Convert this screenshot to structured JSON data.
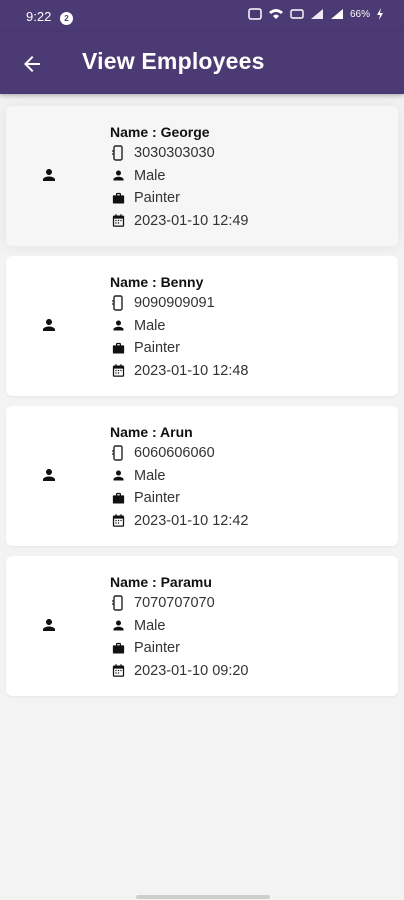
{
  "status": {
    "time": "9:22",
    "badge": "2",
    "battery": "66%"
  },
  "appbar": {
    "title": "View Employees"
  },
  "employees": [
    {
      "name": "Name : George",
      "phone": "3030303030",
      "gender": "Male",
      "job": "Painter",
      "date": "2023-01-10 12:49"
    },
    {
      "name": "Name : Benny",
      "phone": "9090909091",
      "gender": "Male",
      "job": "Painter",
      "date": "2023-01-10 12:48"
    },
    {
      "name": "Name : Arun",
      "phone": "6060606060",
      "gender": "Male",
      "job": "Painter",
      "date": "2023-01-10 12:42"
    },
    {
      "name": "Name : Paramu",
      "phone": "7070707070",
      "gender": "Male",
      "job": "Painter",
      "date": "2023-01-10 09:20"
    }
  ],
  "icons": {
    "back": "arrow-left-icon",
    "avatar": "person-icon",
    "phone": "phone-icon",
    "gender": "person-icon",
    "job": "briefcase-icon",
    "date": "calendar-icon"
  },
  "colors": {
    "primary": "#4b3a73",
    "background": "#f3f3f3",
    "card": "#ffffff"
  }
}
